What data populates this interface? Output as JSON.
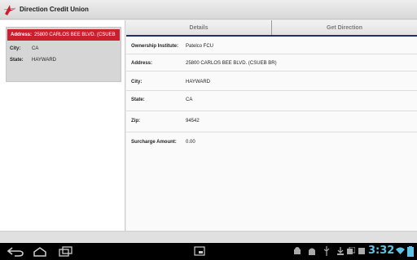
{
  "app": {
    "title": "Direction Credit Union"
  },
  "sidebar": {
    "card": [
      {
        "label": "Address:",
        "value": "25800 CARLOS BEE BLVD. (CSUEB"
      },
      {
        "label": "City:",
        "value": "CA"
      },
      {
        "label": "State:",
        "value": "HAYWARD"
      }
    ]
  },
  "tabs": [
    {
      "label": "Details",
      "selected": true
    },
    {
      "label": "Get Direction",
      "selected": false
    }
  ],
  "details": [
    {
      "label": "Ownership Institute:",
      "value": "Patelco FCU"
    },
    {
      "label": "Address:",
      "value": "25800 CARLOS BEE BLVD. (CSUEB BR)"
    },
    {
      "label": "City:",
      "value": "HAYWARD"
    },
    {
      "label": "State:",
      "value": "CA"
    },
    {
      "label": "Zip:",
      "value": "94542"
    },
    {
      "label": "Surcharge Amount:",
      "value": "0.00"
    }
  ],
  "status_bar": {
    "time": "3:32"
  },
  "colors": {
    "accent": "#cc1f2d",
    "tab_underline": "#1f2f6e",
    "clock": "#5fc3e8"
  }
}
